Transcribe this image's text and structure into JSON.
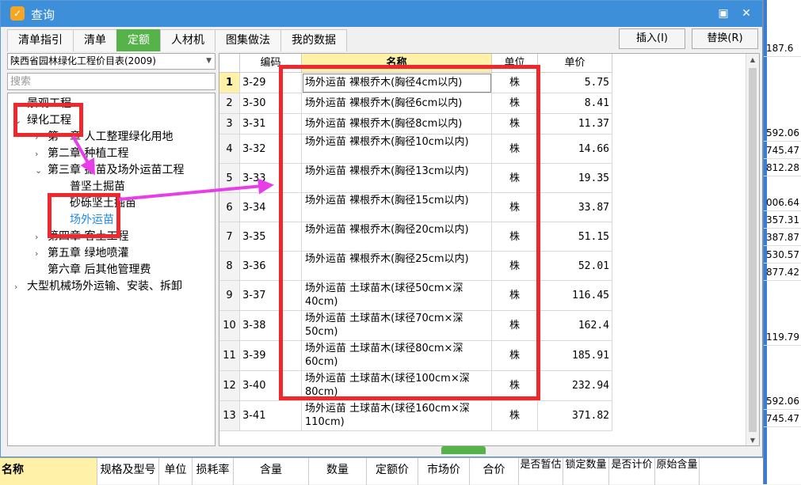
{
  "window": {
    "title": "查询",
    "minimize_glyph": "▣",
    "close_glyph": "✕"
  },
  "tabs": [
    {
      "label": "清单指引",
      "active": false
    },
    {
      "label": "清单",
      "active": false
    },
    {
      "label": "定额",
      "active": true
    },
    {
      "label": "人材机",
      "active": false
    },
    {
      "label": "图集做法",
      "active": false
    },
    {
      "label": "我的数据",
      "active": false
    }
  ],
  "actions": {
    "insert_label": "插入(I)",
    "replace_label": "替换(R)"
  },
  "library": {
    "selected": "陕西省园林绿化工程价目表(2009)"
  },
  "search": {
    "placeholder": "搜索"
  },
  "tree": [
    {
      "label": "景观工程",
      "caret": "›"
    },
    {
      "label": "绿化工程",
      "caret": "⌄"
    },
    {
      "label": "第一章 人工整理绿化用地",
      "caret": "›"
    },
    {
      "label": "第二章 种植工程",
      "caret": "›"
    },
    {
      "label": "第三章 掘苗及场外运苗工程",
      "caret": "⌄"
    },
    {
      "label": "普坚土掘苗",
      "caret": ""
    },
    {
      "label": "砂砾坚土掘苗",
      "caret": ""
    },
    {
      "label": "场外运苗",
      "caret": ""
    },
    {
      "label": "第四章 客土工程",
      "caret": "›"
    },
    {
      "label": "第五章 绿地喷灌",
      "caret": "›"
    },
    {
      "label": "第六章 后其他管理费",
      "caret": ""
    },
    {
      "label": "大型机械场外运输、安装、拆卸",
      "caret": "›"
    }
  ],
  "grid": {
    "headers": {
      "code": "编码",
      "name": "名称",
      "unit": "单位",
      "price": "单价"
    },
    "rows": [
      {
        "n": "1",
        "code": "3-29",
        "name": "场外运苗 裸根乔木(胸径4cm以内)",
        "unit": "株",
        "price": "5.75"
      },
      {
        "n": "2",
        "code": "3-30",
        "name": "场外运苗 裸根乔木(胸径6cm以内)",
        "unit": "株",
        "price": "8.41"
      },
      {
        "n": "3",
        "code": "3-31",
        "name": "场外运苗 裸根乔木(胸径8cm以内)",
        "unit": "株",
        "price": "11.37"
      },
      {
        "n": "4",
        "code": "3-32",
        "name": "场外运苗 裸根乔木(胸径10cm以内)",
        "unit": "株",
        "price": "14.66"
      },
      {
        "n": "5",
        "code": "3-33",
        "name": "场外运苗 裸根乔木(胸径13cm以内)",
        "unit": "株",
        "price": "19.35"
      },
      {
        "n": "6",
        "code": "3-34",
        "name": "场外运苗 裸根乔木(胸径15cm以内)",
        "unit": "株",
        "price": "33.87"
      },
      {
        "n": "7",
        "code": "3-35",
        "name": "场外运苗 裸根乔木(胸径20cm以内)",
        "unit": "株",
        "price": "51.15"
      },
      {
        "n": "8",
        "code": "3-36",
        "name": "场外运苗 裸根乔木(胸径25cm以内)",
        "unit": "株",
        "price": "52.01"
      },
      {
        "n": "9",
        "code": "3-37",
        "name": "场外运苗 土球苗木(球径50cm×深40cm)",
        "unit": "株",
        "price": "116.45"
      },
      {
        "n": "10",
        "code": "3-38",
        "name": "场外运苗 土球苗木(球径70cm×深50cm)",
        "unit": "株",
        "price": "162.4"
      },
      {
        "n": "11",
        "code": "3-39",
        "name": "场外运苗 土球苗木(球径80cm×深60cm)",
        "unit": "株",
        "price": "185.91"
      },
      {
        "n": "12",
        "code": "3-40",
        "name": "场外运苗 土球苗木(球径100cm×深80cm)",
        "unit": "株",
        "price": "232.94"
      },
      {
        "n": "13",
        "code": "3-41",
        "name": "场外运苗 土球苗木(球径160cm×深110cm)",
        "unit": "株",
        "price": "371.82"
      }
    ]
  },
  "bottom_headers": [
    "名称",
    "规格及型号",
    "单位",
    "损耗率",
    "含量",
    "数量",
    "定额价",
    "市场价",
    "合价",
    "是否暂估",
    "锁定数量",
    "是否计价",
    "原始含量"
  ],
  "background_values": [
    "187.6",
    "592.06",
    "745.47",
    "812.28",
    "006.64",
    "357.31",
    "387.87",
    "530.57",
    "877.42",
    "119.79",
    "592.06",
    "745.47"
  ]
}
